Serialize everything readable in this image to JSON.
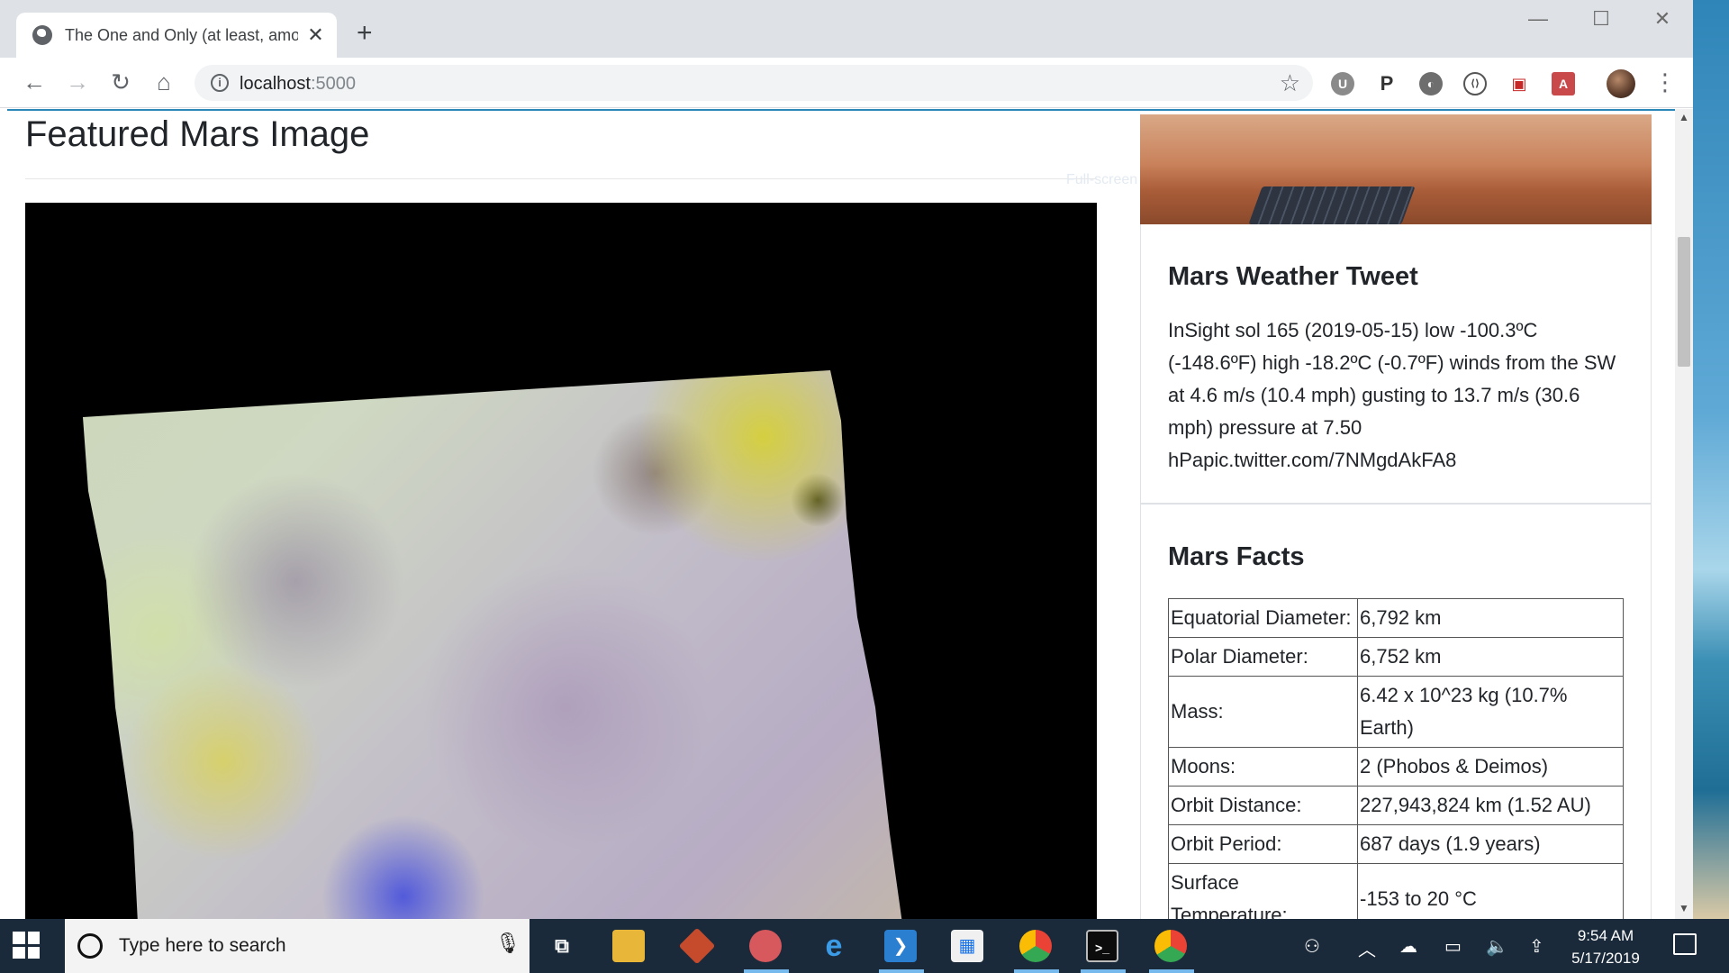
{
  "browser": {
    "tab_title": "The One and Only (at least, amor",
    "tab_close": "✕",
    "new_tab": "+",
    "url_host": "localhost",
    "url_port": ":5000",
    "controls": {
      "minimize": "—",
      "maximize": "☐",
      "close": "✕"
    },
    "nav": {
      "back": "←",
      "forward": "→",
      "reload": "↻",
      "home": "⌂"
    },
    "star": "☆",
    "extensions": [
      "U",
      "P",
      "◐",
      "⟨⟩",
      "▣",
      "A"
    ],
    "menu": "⋮"
  },
  "page": {
    "title": "Featured Mars Image",
    "overlay_text": "Full-screen Snip"
  },
  "weather": {
    "title": "Mars Weather Tweet",
    "text": "InSight sol 165 (2019-05-15) low -100.3ºC (-148.6ºF) high -18.2ºC (-0.7ºF) winds from the SW at 4.6 m/s (10.4 mph) gusting to 13.7 m/s (30.6 mph) pressure at 7.50 hPapic.twitter.com/7NMgdAkFA8"
  },
  "facts": {
    "title": "Mars Facts",
    "rows": [
      {
        "label": "Equatorial Diameter:",
        "value": "6,792 km"
      },
      {
        "label": "Polar Diameter:",
        "value": "6,752 km"
      },
      {
        "label": "Mass:",
        "value": "6.42 x 10^23 kg (10.7% Earth)"
      },
      {
        "label": "Moons:",
        "value": "2 (Phobos & Deimos)"
      },
      {
        "label": "Orbit Distance:",
        "value": "227,943,824 km (1.52 AU)"
      },
      {
        "label": "Orbit Period:",
        "value": "687 days (1.9 years)"
      },
      {
        "label": "Surface Temperature:",
        "value": "-153 to 20 °C"
      }
    ]
  },
  "taskbar": {
    "search_placeholder": "Type here to search",
    "time": "9:54 AM",
    "date": "5/17/2019",
    "apps": [
      "task-view",
      "file-explorer",
      "git-gui",
      "snip-tool",
      "edge",
      "vs-code",
      "store",
      "chrome-dev",
      "terminal",
      "chrome"
    ]
  },
  "colors": {
    "accent": "#2a87b8",
    "taskbar": "#1b2a3a",
    "tab_strip": "#dee1e6"
  }
}
